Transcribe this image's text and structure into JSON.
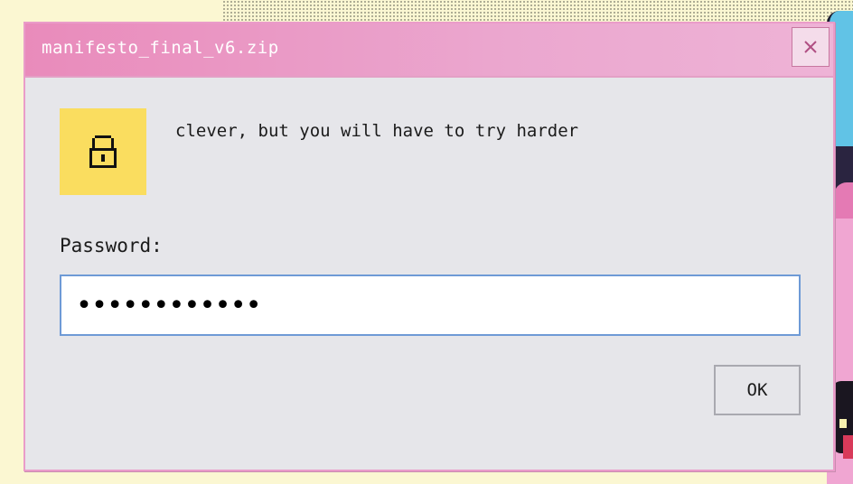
{
  "dialog": {
    "title": "manifesto_final_v6.zip",
    "close_icon": "close-icon",
    "lock_icon": "lock-icon",
    "message": "clever, but you will have to try harder",
    "password_label": "Password:",
    "password_value": "••••••••••••",
    "ok_label": "OK"
  },
  "colors": {
    "titlebar_start": "#e98bbb",
    "titlebar_end": "#eeb3d6",
    "dialog_bg": "#e6e6ea",
    "lock_tile": "#fadd5f",
    "input_border": "#6e9ad6",
    "desktop_bg": "#fbf7d2"
  }
}
